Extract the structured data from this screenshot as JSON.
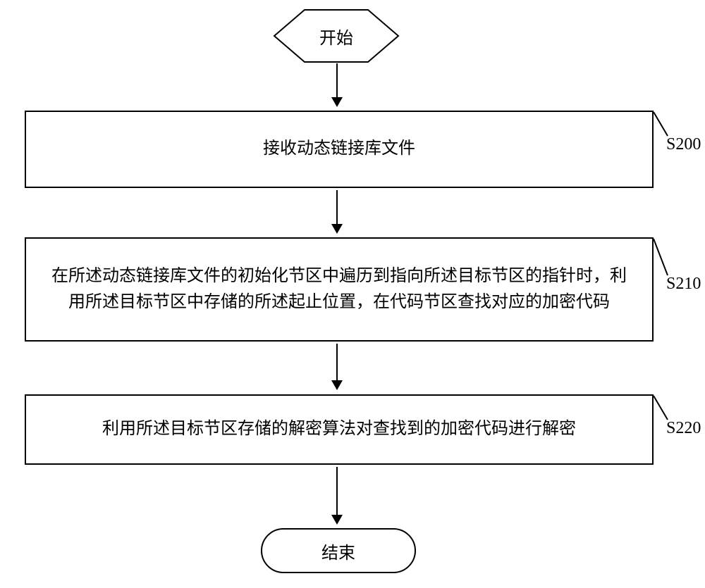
{
  "flow": {
    "start": "开始",
    "end": "结束",
    "steps": [
      {
        "label": "S200",
        "text": "接收动态链接库文件"
      },
      {
        "label": "S210",
        "text": "在所述动态链接库文件的初始化节区中遍历到指向所述目标节区的指针时，利用所述目标节区中存储的所述起止位置，在代码节区查找对应的加密代码"
      },
      {
        "label": "S220",
        "text": "利用所述目标节区存储的解密算法对查找到的加密代码进行解密"
      }
    ]
  }
}
